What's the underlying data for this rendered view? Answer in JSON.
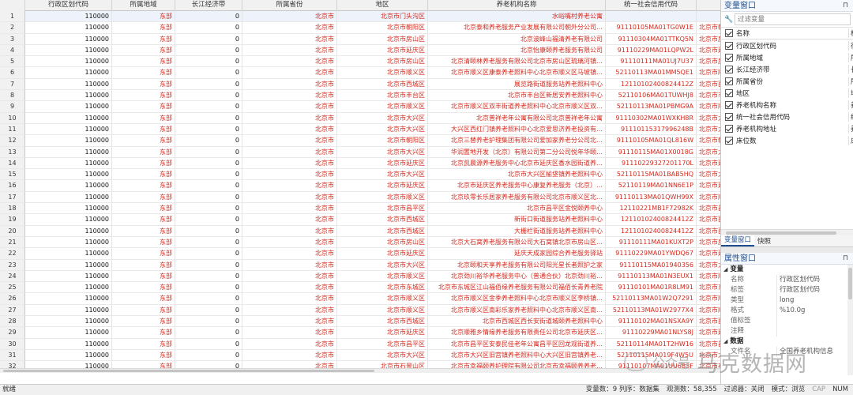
{
  "grid": {
    "columns": [
      "行政区划代码",
      "所属地域",
      "长江经济带",
      "所属省份",
      "地区",
      "养老机构名称",
      "统一社会信用代码",
      "养老机"
    ],
    "rows": [
      [
        "110000",
        "东部",
        "0",
        "北京市",
        "北京市门头沟区",
        "水峪嘴村养老公寓",
        "",
        ""
      ],
      [
        "110000",
        "东部",
        "0",
        "北京市",
        "北京市朝阳区",
        "北京泰和养老服务产业发展有限公司朝外分公司…",
        "91110105MA01TG0W1E",
        "北京市朝阳区朝外街道北京市朝阳"
      ],
      [
        "110000",
        "东部",
        "0",
        "北京市",
        "北京市房山区",
        "北京波峰山福清养老有限公司",
        "91110304MA01TTKQ5N",
        "北京市房山区北京市房山区周口店"
      ],
      [
        "110000",
        "东部",
        "0",
        "北京市",
        "北京市延庆区",
        "北京怡康颐养老服务有限公司",
        "91110229MA01LQPW2L",
        "北京市延庆区张山营镇北京市延庆"
      ],
      [
        "110000",
        "东部",
        "0",
        "北京市",
        "北京市房山区",
        "北京清颐林养老服务有限公司北京市房山区琉璃河镇…",
        "91110111MA01UJ7U37",
        "北京市房山区琉璃河镇北京市房山"
      ],
      [
        "110000",
        "东部",
        "0",
        "北京市",
        "北京市顺义区",
        "北京市顺义区康泰养老照料中心北京市顺义区马坡镇…",
        "52110113MA01MM5QE1",
        "北京市顺义区马坡镇北京市顺义区"
      ],
      [
        "110000",
        "东部",
        "0",
        "北京市",
        "北京市西城区",
        "展览路街道服务站养老照料中心",
        "12110102400824412Z",
        "北京市西城区展览路街道北京市西"
      ],
      [
        "110000",
        "东部",
        "0",
        "北京市",
        "北京市丰台区",
        "北京市丰台区新居安养老照料中心",
        "52110106MA01TUWHJ8",
        "北京市丰台区北京市丰台区新村街"
      ],
      [
        "110000",
        "东部",
        "0",
        "北京市",
        "北京市顺义区",
        "北京市顺义区双丰街道养老照料中心北京市顺义区双…",
        "52110113MA01PBMG9A",
        "北京市顺义区双丰街道北京市顺义"
      ],
      [
        "110000",
        "东部",
        "0",
        "北京市",
        "北京市大兴区",
        "北京普祥老年公寓有限公司北京普祥老年公寓",
        "91110302MA01WXKH8R",
        "北京市大兴区亦庄镇北京市北京经济"
      ],
      [
        "110000",
        "东部",
        "0",
        "北京市",
        "北京市大兴区",
        "大兴区西红门镇养老照料中心北京爱思济养老投资有…",
        "91110115317996248B",
        "北京市大兴区西红门镇北京市大兴"
      ],
      [
        "110000",
        "东部",
        "0",
        "北京市",
        "北京市朝阳区",
        "北京三替养老护理集团有限公司爱加家养老分公司北…",
        "91110105MA01QL816W",
        "北京市朝阳区北苑乡北京市朝阳区"
      ],
      [
        "110000",
        "东部",
        "0",
        "北京市",
        "北京市大兴区",
        "华润置地开发（北京）有限公司第二分公司悦年华颐…",
        "91110115MA01X0018G",
        "北京市大兴区黄村镇北京市大兴区"
      ],
      [
        "110000",
        "东部",
        "0",
        "北京市",
        "北京市延庆区",
        "北京凯晨源养老服务中心北京市延庆区香水园街道养…",
        "91110229327201170L",
        "北京市延庆区香水园街道北京市延"
      ],
      [
        "110000",
        "东部",
        "0",
        "北京市",
        "北京市大兴区",
        "北京市大兴区榆垡镇养老照料中心",
        "52110115MA01BAB5HQ",
        "北京市大兴区榆垡镇北京市大兴区"
      ],
      [
        "110000",
        "东部",
        "0",
        "北京市",
        "北京市延庆区",
        "北京市延庆区养老服务中心康复养老服务（北京）…",
        "52110119MA01NN6E1P",
        "北京市延庆区北京市延庆区湖南东"
      ],
      [
        "110000",
        "东部",
        "0",
        "北京市",
        "北京市顺义区",
        "北京玖零长乐居家养老服务有限公司北京市顺义区北…",
        "91110113MA01QWH99X",
        "北京市顺义区北石槽镇北京市顺义"
      ],
      [
        "110000",
        "东部",
        "0",
        "北京市",
        "北京市昌平区",
        "北京市昌平区金悦颐养中心",
        "12110221MB1F72982K",
        "北京市昌平区回龙观街道北京市昌"
      ],
      [
        "110000",
        "东部",
        "0",
        "北京市",
        "北京市西城区",
        "新街口街道服务站养老照料中心",
        "12110102400824412Z",
        "北京市西城区新街口街道北京市西"
      ],
      [
        "110000",
        "东部",
        "0",
        "北京市",
        "北京市西城区",
        "大栅栏街道服务站养老照料中心",
        "12110102400824412Z",
        "北京市西城区大栅栏街道北京市西"
      ],
      [
        "110000",
        "东部",
        "0",
        "北京市",
        "北京市房山区",
        "北京大石窝养老服务有限公司大石窝镇北京市房山区…",
        "91110111MA01KUXT2P",
        "北京市房山区大石窝镇北京市房山"
      ],
      [
        "110000",
        "东部",
        "0",
        "北京市",
        "北京市延庆区",
        "延庆天成家园综合养老服务驿站",
        "91110229MA01YWDQ67",
        "北京市延庆区沈家营镇北京市延庆"
      ],
      [
        "110000",
        "东部",
        "0",
        "北京市",
        "北京市大兴区",
        "北京颐和天享养老服务有限公司阳光星长者照护之家",
        "91110115MA01940356",
        "北京市大兴区观音寺街道北京市大"
      ],
      [
        "110000",
        "东部",
        "0",
        "北京市",
        "北京市顺义区",
        "北京劲川裕华养老服务中心（普通合伙）北京劲川裕…",
        "91110113MA01N3EUX1",
        "北京市顺义区北京市顺义区劲川镇"
      ],
      [
        "110000",
        "东部",
        "0",
        "北京市",
        "北京市东城区",
        "北京市东城区江山福佰缘养老服务有限公司福佰长青养老院",
        "91110101MA01R8LM91",
        "北京市东城区体育馆路街道北京市"
      ],
      [
        "110000",
        "东部",
        "0",
        "北京市",
        "北京市顺义区",
        "北京市顺义区金季养老照料中心北京市顺义区李桥镇…",
        "52110113MA01W2Q7291",
        "北京市顺义区李桥镇北京市顺义区"
      ],
      [
        "110000",
        "东部",
        "0",
        "北京市",
        "北京市顺义区",
        "北京市顺义区南彩乐家养老照料中心北京市顺义区南…",
        "52110113MA01W2977X4",
        "北京市顺义区南彩镇北京市顺义区"
      ],
      [
        "110000",
        "东部",
        "0",
        "北京市",
        "北京市西城区",
        "北京市西城区西长安街道城颐养老照料中心",
        "91110102MA01NSXA9Y",
        "北京市西城区西长安街街道北京市"
      ],
      [
        "110000",
        "东部",
        "0",
        "北京市",
        "北京市延庆区",
        "北京顺雅乡情缘养老服务有限责任公司北京市延庆区…",
        "91110229MA01NLYS8J",
        "北京市延庆区张山营镇北京市延庆"
      ],
      [
        "110000",
        "东部",
        "0",
        "北京市",
        "北京市昌平区",
        "北京市昌平区安泰民佳老年公寓昌平区回龙观街道养…",
        "52110114MA01T2HW16",
        "北京市昌平区回龙观街道北京市昌"
      ],
      [
        "110000",
        "东部",
        "0",
        "北京市",
        "北京市大兴区",
        "北京市大兴区旧宫镇养老照料中心大兴区旧宫镇养老…",
        "52110115MA019F4W5U",
        "北京市大兴区旧宫镇北京市大兴区"
      ],
      [
        "110000",
        "东部",
        "0",
        "北京市",
        "北京市石景山区",
        "北京市幸福颐养护理院有限公司北京市幸福颐养养老…",
        "91110107MA01UU6B3F",
        "北京市石景山区八角街道北京市石"
      ],
      [
        "110000",
        "东部",
        "0",
        "北京市",
        "北京市顺义区",
        "北京市顺义区北务镇养老照料中心北京市顺义区北务…",
        "52110113MA01RUX95N",
        "北京市顺义区北务镇北京市顺义区"
      ]
    ]
  },
  "var_panel": {
    "title": "变量窗口",
    "filter_placeholder": "过滤变量",
    "header_name": "名称",
    "header_label": "标",
    "vars": [
      {
        "name": "行政区划代码",
        "label": "行"
      },
      {
        "name": "所属地域",
        "label": "所"
      },
      {
        "name": "长江经济带",
        "label": "长"
      },
      {
        "name": "所属省份",
        "label": "所"
      },
      {
        "name": "地区",
        "label": "地"
      },
      {
        "name": "养老机构名称",
        "label": "养"
      },
      {
        "name": "统一社会信用代码",
        "label": "统"
      },
      {
        "name": "养老机构地址",
        "label": "养"
      },
      {
        "name": "床位数",
        "label": "床"
      }
    ],
    "tabs": [
      "变量窗口",
      "快照"
    ]
  },
  "prop_panel": {
    "title": "属性窗口",
    "section_var": "变量",
    "props": [
      {
        "k": "名称",
        "v": "行政区划代码"
      },
      {
        "k": "标签",
        "v": "行政区划代码"
      },
      {
        "k": "类型",
        "v": "long"
      },
      {
        "k": "格式",
        "v": "%10.0g"
      },
      {
        "k": "值标签",
        "v": ""
      },
      {
        "k": "注释",
        "v": ""
      }
    ],
    "section_data": "数据",
    "data_props": [
      {
        "k": "文件名",
        "v": "全国养老机构信息"
      }
    ]
  },
  "status": {
    "left": "就绪",
    "items": [
      {
        "text": "变量数：9  列序：数据集",
        "dim": false
      },
      {
        "text": "观测数：58,355",
        "dim": false
      },
      {
        "text": "过滤器：关闭",
        "dim": false
      },
      {
        "text": "模式：浏览",
        "dim": false
      },
      {
        "text": "CAP",
        "dim": true
      },
      {
        "text": "NUM",
        "dim": false
      }
    ]
  },
  "watermark": {
    "prefix": "公众号",
    "brand": "马克数据网"
  }
}
